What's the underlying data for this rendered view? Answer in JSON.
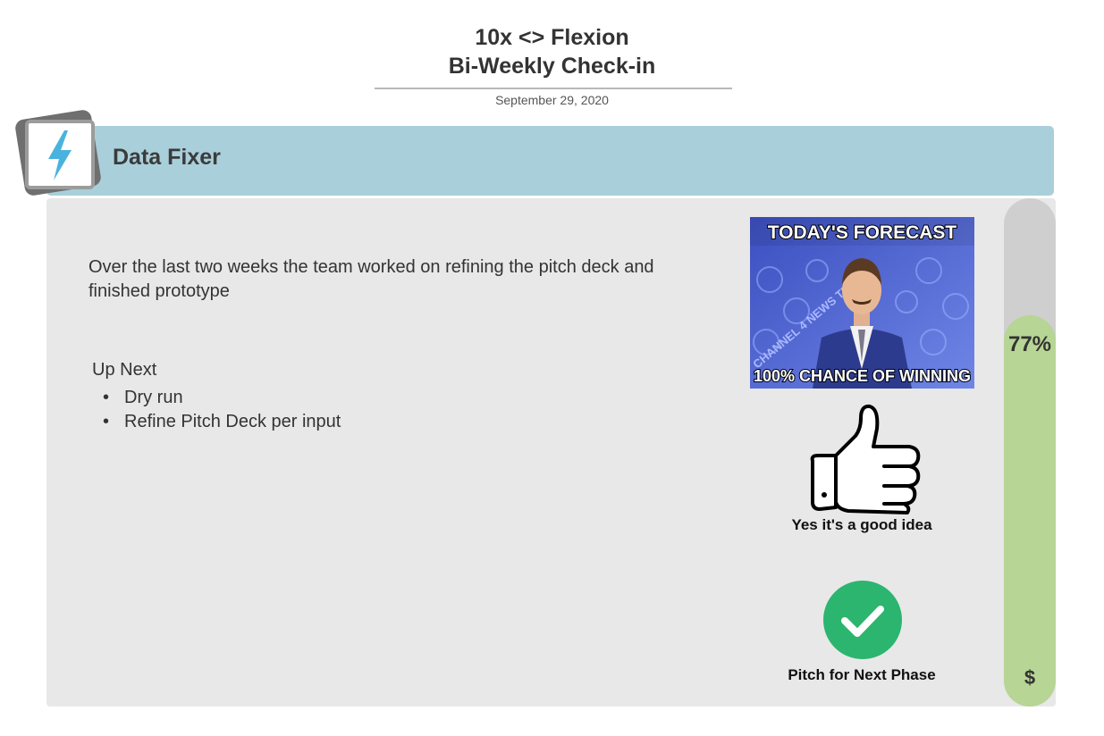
{
  "header": {
    "title_line1": "10x <> Flexion",
    "title_line2": "Bi-Weekly Check-in",
    "date": "September 29, 2020"
  },
  "project": {
    "name": "Data Fixer",
    "icon": "lightning-bolt-icon"
  },
  "summary": "Over the last two weeks the team worked on refining  the pitch deck and finished prototype",
  "up_next": {
    "heading": "Up Next",
    "items": [
      "Dry run",
      "Refine Pitch Deck per input"
    ]
  },
  "meme": {
    "top_text": "TODAY'S FORECAST",
    "bottom_text": "100% CHANCE OF WINNING",
    "background_text": "CHANNEL 4 NEWS TEAM"
  },
  "verdict": {
    "icon": "thumbs-up-icon",
    "caption": "Yes it's a good idea"
  },
  "outcome": {
    "icon": "check-circle-icon",
    "caption": "Pitch for Next Phase",
    "color": "#2bb56f"
  },
  "progress": {
    "value": 0.77,
    "label": "77%",
    "bottom_symbol": "$",
    "fill_color": "#b7d594",
    "track_color": "#cfcfcf"
  },
  "colors": {
    "banner": "#a9cfdb",
    "panel": "#e8e8e8",
    "icon_accent": "#4ab3dd"
  }
}
